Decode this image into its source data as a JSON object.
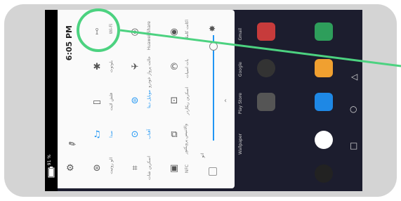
{
  "status": {
    "time": "6:05 PM",
    "battery": "91 %"
  },
  "tiles": {
    "wifi": "Wi-Fi",
    "hotspot": "Huawei Share",
    "location": "اکانت کاملا",
    "bluetooth": "بلوتوث",
    "airplane": "حالت پرواز خودرو",
    "sync": "بات اسیات",
    "flashlight": "فلش لایت",
    "rotate": "موبایل دیتا",
    "screenshot": "اسکرین ریکاردر",
    "sound": "صدا",
    "screen": "آفتاب",
    "vibration": "حالت",
    "cast": "والاتنیس پرویکتور",
    "rotation": "چرخش خودکار",
    "crop": "اسکرین شات",
    "nfc": "NFC",
    "lock": "الو روتیت"
  },
  "brightness": {
    "auto_label": "اتو"
  },
  "home_apps": {
    "labels": [
      "Gmail",
      "Google",
      "Play Store",
      "Wallpaper"
    ]
  },
  "colors": {
    "accent": "#2196f3",
    "highlight": "#4cd280"
  }
}
